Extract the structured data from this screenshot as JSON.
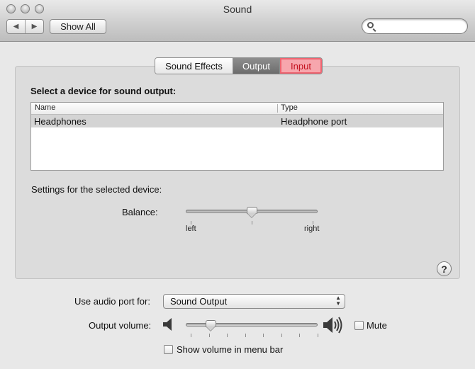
{
  "window": {
    "title": "Sound",
    "show_all_label": "Show All",
    "nav_back_glyph": "◀",
    "nav_forward_glyph": "▶",
    "search_placeholder": ""
  },
  "tabs": [
    {
      "label": "Sound Effects",
      "state": "normal"
    },
    {
      "label": "Output",
      "state": "selected"
    },
    {
      "label": "Input",
      "state": "highlighted"
    }
  ],
  "output": {
    "section_title": "Select a device for sound output:",
    "table": {
      "columns": [
        "Name",
        "Type"
      ],
      "rows": [
        {
          "name": "Headphones",
          "type": "Headphone port",
          "selected": true
        }
      ]
    },
    "settings_label": "Settings for the selected device:",
    "balance": {
      "label": "Balance:",
      "left_label": "left",
      "right_label": "right",
      "value": 0.5
    },
    "help_glyph": "?"
  },
  "bottom": {
    "audio_port_label": "Use audio port for:",
    "audio_port_value": "Sound Output",
    "output_volume_label": "Output volume:",
    "output_volume_value": 0.15,
    "mute_label": "Mute",
    "mute_checked": false,
    "show_volume_label": "Show volume in menu bar",
    "show_volume_checked": false
  },
  "colors": {
    "highlight_tab_bg": "#f7a6ad",
    "highlight_tab_text": "#c2101d",
    "selected_tab_bg": "#7a7a7a"
  }
}
